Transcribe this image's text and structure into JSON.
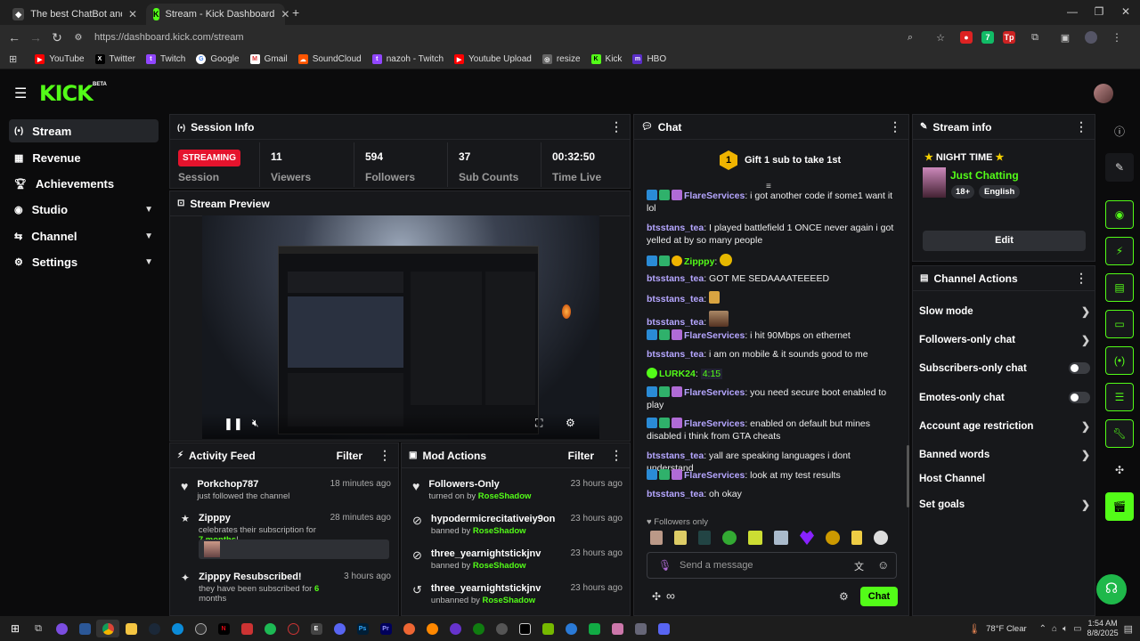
{
  "browser": {
    "tabs": [
      {
        "label": "The best ChatBot and Widgets"
      },
      {
        "label": "Stream - Kick Dashboard"
      }
    ],
    "url": "https://dashboard.kick.com/stream",
    "bookmarks": [
      "YouTube",
      "Twitter",
      "Twitch",
      "Google",
      "Gmail",
      "SoundCloud",
      "nazoh - Twitch",
      "Youtube Upload",
      "resize",
      "Kick",
      "HBO"
    ]
  },
  "app": {
    "logo": "KICK",
    "beta": "BETA"
  },
  "sidebar": {
    "items": [
      {
        "label": "Stream",
        "icon": "broadcast-icon"
      },
      {
        "label": "Revenue",
        "icon": "chart-icon"
      },
      {
        "label": "Achievements",
        "icon": "trophy-icon"
      },
      {
        "label": "Studio",
        "icon": "studio-icon"
      },
      {
        "label": "Channel",
        "icon": "channel-icon"
      },
      {
        "label": "Settings",
        "icon": "gear-icon"
      }
    ]
  },
  "session": {
    "title": "Session Info",
    "status": "STREAMING",
    "status_label": "Session",
    "stats": [
      {
        "value": "11",
        "label": "Viewers"
      },
      {
        "value": "594",
        "label": "Followers"
      },
      {
        "value": "37",
        "label": "Sub Counts"
      },
      {
        "value": "00:32:50",
        "label": "Time Live"
      }
    ]
  },
  "preview": {
    "title": "Stream Preview"
  },
  "activity": {
    "title": "Activity Feed",
    "filter": "Filter",
    "items": [
      {
        "name": "Porkchop787",
        "desc": "just followed the channel",
        "time": "18 minutes ago"
      },
      {
        "name": "Zipppy",
        "desc_pre": "celebrates their subscription for ",
        "desc_hl": "7 months",
        "desc_post": "!",
        "time": "28 minutes ago"
      },
      {
        "name": "Zipppy Resubscribed!",
        "desc_pre": "they have been subscribed for ",
        "desc_hl": "6",
        "desc_post": " months",
        "time": "3 hours ago"
      }
    ]
  },
  "mod": {
    "title": "Mod Actions",
    "filter": "Filter",
    "items": [
      {
        "name": "Followers-Only",
        "desc": "turned on by ",
        "by": "RoseShadow",
        "time": "23 hours ago"
      },
      {
        "name": "hypodermicrecitativeiy9on",
        "desc": "banned by ",
        "by": "RoseShadow",
        "time": "23 hours ago"
      },
      {
        "name": "three_yearnightstickjnv",
        "desc": "banned by ",
        "by": "RoseShadow",
        "time": "23 hours ago"
      },
      {
        "name": "three_yearnightstickjnv",
        "desc": "unbanned by ",
        "by": "RoseShadow",
        "time": "23 hours ago"
      }
    ]
  },
  "chat": {
    "title": "Chat",
    "gift": "Gift 1 sub to take 1st",
    "gift_rank": "1",
    "messages": [
      {
        "user": "FlareServices",
        "text": "i got another code if some1 want it lol"
      },
      {
        "user": "btsstans_tea",
        "text": "I played battlefield 1 ONCE never again i got yelled at by so many people"
      },
      {
        "user": "Zipppy",
        "text": ""
      },
      {
        "user": "btsstans_tea",
        "text": "GOT ME SEDAAAATEEEED"
      },
      {
        "user": "btsstans_tea",
        "text": ""
      },
      {
        "user": "btsstans_tea",
        "text": ""
      },
      {
        "user": "FlareServices",
        "text": "i hit 90Mbps on ethernet"
      },
      {
        "user": "btsstans_tea",
        "text": "i am on mobile & it sounds good to me"
      },
      {
        "user": "LURK24",
        "text": "4:15"
      },
      {
        "user": "FlareServices",
        "text": "you need secure boot enabled to play"
      },
      {
        "user": "FlareServices",
        "text": "enabled on default but mines disabled i think from GTA cheats"
      },
      {
        "user": "btsstans_tea",
        "text": "yall are speaking languages i dont understand"
      },
      {
        "user": "FlareServices",
        "text": "look at my test results"
      },
      {
        "user": "btsstans_tea",
        "text": "oh okay"
      }
    ],
    "followers_only": "Followers only",
    "placeholder": "Send a message",
    "send": "Chat"
  },
  "stream_info": {
    "title": "Stream info",
    "stream_title": "NIGHT TIME",
    "category": "Just Chatting",
    "tags": [
      "18+",
      "English"
    ],
    "edit": "Edit"
  },
  "channel_actions": {
    "title": "Channel Actions",
    "items": [
      {
        "label": "Slow mode",
        "type": "arrow"
      },
      {
        "label": "Followers-only chat",
        "type": "arrow"
      },
      {
        "label": "Subscribers-only chat",
        "type": "toggle"
      },
      {
        "label": "Emotes-only chat",
        "type": "toggle"
      },
      {
        "label": "Account age restriction",
        "type": "arrow"
      },
      {
        "label": "Banned words",
        "type": "arrow"
      },
      {
        "label": "Host Channel",
        "type": "none"
      },
      {
        "label": "Set goals",
        "type": "arrow"
      }
    ]
  },
  "taskbar": {
    "weather": "78°F  Clear",
    "time": "1:54 AM",
    "date": "8/8/2025"
  },
  "colors": {
    "accent": "#53fc18",
    "streaming": "#e5132d",
    "panel": "#17181b"
  }
}
